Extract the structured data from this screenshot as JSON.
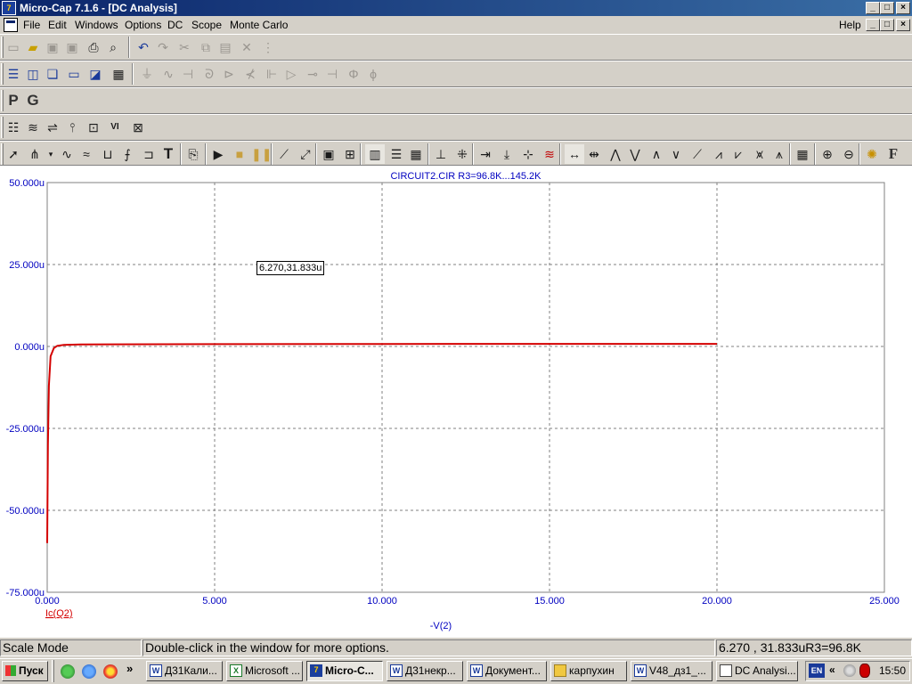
{
  "window": {
    "title": "Micro-Cap 7.1.6 - [DC Analysis]",
    "app_icon": "7",
    "controls": [
      "_",
      "□",
      "×"
    ]
  },
  "menu": {
    "items": [
      "File",
      "Edit",
      "Windows",
      "Options",
      "DC",
      "Scope",
      "Monte Carlo"
    ],
    "help": "Help"
  },
  "toolbar3": {
    "p_label": "P",
    "g_label": "G"
  },
  "toolbar5": {
    "text_tool": "T",
    "format": "F"
  },
  "plot": {
    "title": "CIRCUIT2.CIR R3=96.8K...145.2K",
    "cursor_label": "6.270,31.833u",
    "curve_color": "#d40000",
    "axis_text_color": "#0000c0"
  },
  "chart_data": {
    "type": "line",
    "title": "CIRCUIT2.CIR R3=96.8K...145.2K",
    "xlabel": "-V(2)",
    "ylabel": "",
    "xlim": [
      0,
      25
    ],
    "ylim": [
      -75,
      50
    ],
    "xticks": [
      "0.000",
      "5.000",
      "10.000",
      "15.000",
      "20.000",
      "25.000"
    ],
    "yticks": [
      "50.000u",
      "25.000u",
      "0.000u",
      "-25.000u",
      "-50.000u",
      "-75.000u"
    ],
    "grid": true,
    "series": [
      {
        "name": "Ic(Q2)",
        "x": [
          0,
          0.02,
          0.05,
          0.1,
          0.2,
          0.3,
          0.5,
          1,
          2,
          5,
          10,
          15,
          20
        ],
        "y": [
          -60,
          -30,
          -12,
          -3,
          -0.5,
          0.2,
          0.5,
          0.6,
          0.65,
          0.7,
          0.75,
          0.78,
          0.8
        ]
      }
    ]
  },
  "status": {
    "mode": "Scale Mode",
    "hint": "Double-click in the window for more options.",
    "readout": "6.270 , 31.833uR3=96.8K"
  },
  "taskbar": {
    "start": "Пуск",
    "more": "»",
    "tasks": [
      {
        "label": "Д31Кали...",
        "icon": "W"
      },
      {
        "label": "Microsoft ...",
        "icon": "X"
      },
      {
        "label": "Micro-C...",
        "icon": "7",
        "active": true
      },
      {
        "label": "Д31некр...",
        "icon": "W"
      },
      {
        "label": "Документ...",
        "icon": "W"
      },
      {
        "label": "карпухин",
        "icon": "folder"
      },
      {
        "label": "V48_дз1_...",
        "icon": "W"
      },
      {
        "label": "DC Analysi...",
        "icon": "doc"
      }
    ],
    "tray": {
      "lang": "EN",
      "arrows": "«",
      "time": "15:50"
    }
  }
}
